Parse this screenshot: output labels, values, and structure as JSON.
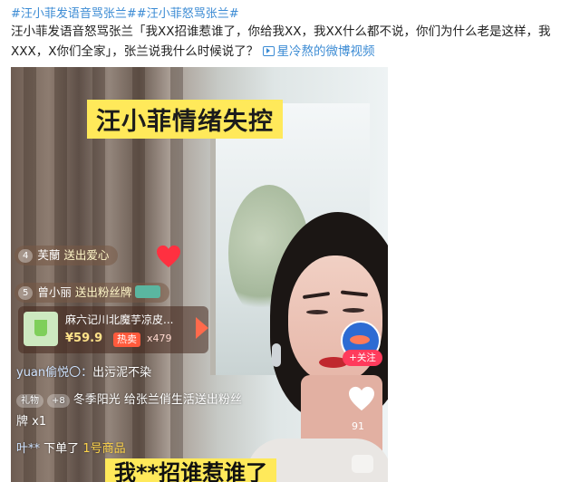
{
  "post": {
    "topics": [
      "#汪小菲发语音骂张兰#",
      "#汪小菲怒骂张兰#"
    ],
    "caption": "汪小菲发语音怒骂张兰「我XX招谁惹谁了，你给我XX，我XX什么都不说，你们为什么老是这样，我XXX，X你们全家」，张兰说我什么时候说了？",
    "source_label": "星冷熬的微博视频"
  },
  "video": {
    "overlay_title": "汪小菲情绪失控",
    "subtitle": "我**招谁惹谁了",
    "gift_feed": [
      {
        "level": "4",
        "user": "芙蘭",
        "action": "送出爱心"
      },
      {
        "level": "5",
        "user": "曾小丽",
        "action": "送出粉丝牌"
      }
    ],
    "product": {
      "name": "麻六记川北魔芋凉皮...",
      "price": "¥59.9",
      "hot_label": "热卖",
      "sales": "x479"
    },
    "chat": [
      {
        "tag": "",
        "name": "yuan偷悦〇：",
        "text": "出污泥不染"
      },
      {
        "tag": "礼物",
        "level": "8",
        "name": "冬季阳光",
        "text": "给张兰俏生活送出粉丝"
      },
      {
        "tag": "",
        "name": "",
        "text": "牌 x1"
      },
      {
        "tag": "",
        "name": "叶**",
        "text": "下单了",
        "extra": "1号商品"
      }
    ],
    "follow_label": "+关注",
    "like_count": "91",
    "colors": {
      "accent_yellow": "#ffe95a",
      "follow_red": "#ff3b5c",
      "topic_blue": "#3b8bd4"
    }
  }
}
